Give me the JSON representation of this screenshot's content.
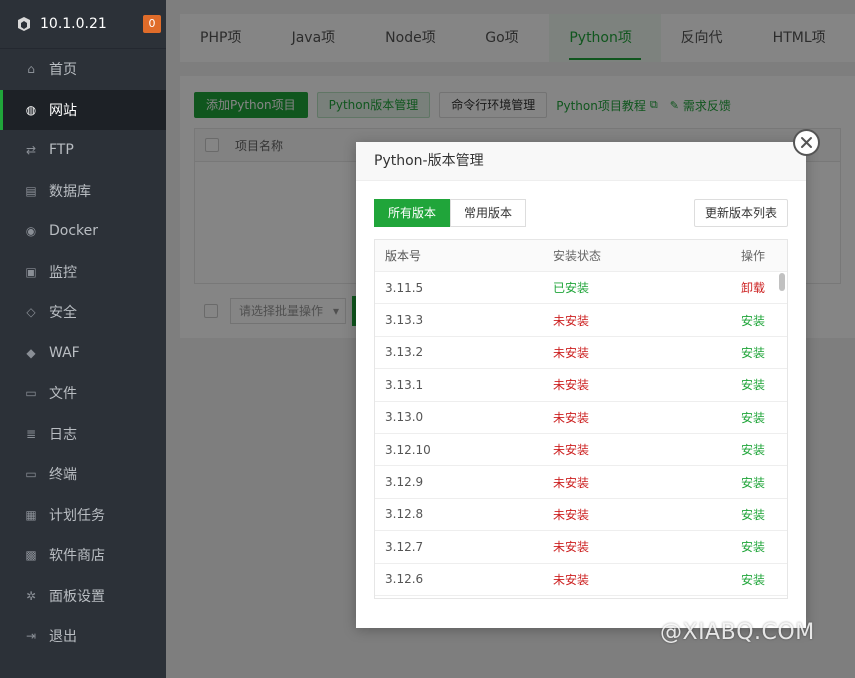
{
  "sidebar": {
    "host": "10.1.0.21",
    "badge": "0",
    "items": [
      {
        "label": "首页",
        "icon": "home-icon"
      },
      {
        "label": "网站",
        "icon": "globe-icon",
        "active": true
      },
      {
        "label": "FTP",
        "icon": "ftp-icon"
      },
      {
        "label": "数据库",
        "icon": "database-icon"
      },
      {
        "label": "Docker",
        "icon": "docker-icon"
      },
      {
        "label": "监控",
        "icon": "monitor-icon"
      },
      {
        "label": "安全",
        "icon": "shield-icon"
      },
      {
        "label": "WAF",
        "icon": "waf-shield-icon"
      },
      {
        "label": "文件",
        "icon": "folder-icon"
      },
      {
        "label": "日志",
        "icon": "log-icon"
      },
      {
        "label": "终端",
        "icon": "terminal-icon"
      },
      {
        "label": "计划任务",
        "icon": "calendar-icon"
      },
      {
        "label": "软件商店",
        "icon": "apps-icon"
      },
      {
        "label": "面板设置",
        "icon": "gear-icon"
      },
      {
        "label": "退出",
        "icon": "logout-icon"
      }
    ]
  },
  "tabs": [
    "PHP项目",
    "Java项目",
    "Node项目",
    "Go项目",
    "Python项目",
    "反向代理",
    "HTML项目"
  ],
  "active_tab": "Python项目",
  "toolbar": {
    "add_python": "添加Python项目",
    "python_version_mgmt": "Python版本管理",
    "cli_env_mgmt": "命令行环境管理",
    "tutorial": "Python项目教程",
    "feedback": "需求反馈"
  },
  "project_table": {
    "col_name": "项目名称",
    "batch_placeholder": "请选择批量操作"
  },
  "modal": {
    "title": "Python-版本管理",
    "seg_all": "所有版本",
    "seg_common": "常用版本",
    "refresh": "更新版本列表",
    "headers": {
      "version": "版本号",
      "status": "安装状态",
      "action": "操作"
    },
    "rows": [
      {
        "version": "3.11.5",
        "status": "已安装",
        "action": "卸载",
        "installed": true
      },
      {
        "version": "3.13.3",
        "status": "未安装",
        "action": "安装",
        "installed": false
      },
      {
        "version": "3.13.2",
        "status": "未安装",
        "action": "安装",
        "installed": false
      },
      {
        "version": "3.13.1",
        "status": "未安装",
        "action": "安装",
        "installed": false
      },
      {
        "version": "3.13.0",
        "status": "未安装",
        "action": "安装",
        "installed": false
      },
      {
        "version": "3.12.10",
        "status": "未安装",
        "action": "安装",
        "installed": false
      },
      {
        "version": "3.12.9",
        "status": "未安装",
        "action": "安装",
        "installed": false
      },
      {
        "version": "3.12.8",
        "status": "未安装",
        "action": "安装",
        "installed": false
      },
      {
        "version": "3.12.7",
        "status": "未安装",
        "action": "安装",
        "installed": false
      },
      {
        "version": "3.12.6",
        "status": "未安装",
        "action": "安装",
        "installed": false
      }
    ]
  },
  "watermark": "@XIABQ.COM",
  "colors": {
    "accent": "#20a53a",
    "danger": "#cc2020",
    "sidebar": "#2c3138",
    "badge": "#e06c2a"
  }
}
